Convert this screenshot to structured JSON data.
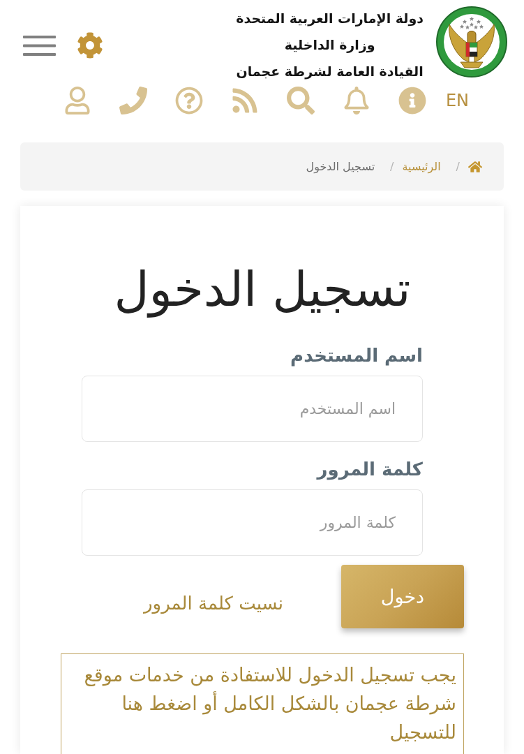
{
  "header": {
    "titles": [
      "دولة الإمارات العربية المتحدة",
      "وزارة الداخلية",
      "القيادة العامة لشرطة عجمان"
    ],
    "language_button": "EN"
  },
  "breadcrumb": [
    {
      "separator": "/",
      "label": "الرئيسية",
      "current": false
    },
    {
      "separator": "/",
      "label": "تسجيل الدخول",
      "current": true
    }
  ],
  "login": {
    "title": "تسجيل الدخول",
    "fields": [
      {
        "label": "اسم المستخدم",
        "placeholder": "اسم المستخدم"
      },
      {
        "label": "كلمة المرور",
        "placeholder": "كلمة المرور"
      }
    ],
    "submit_button": "دخول",
    "forgot_password_link": "نسيت كلمة المرور",
    "notice": "يجب تسجيل الدخول للاستفادة من خدمات موقع شرطة عجمان بالشكل الكامل أو اضغط هنا للتسجيل"
  }
}
